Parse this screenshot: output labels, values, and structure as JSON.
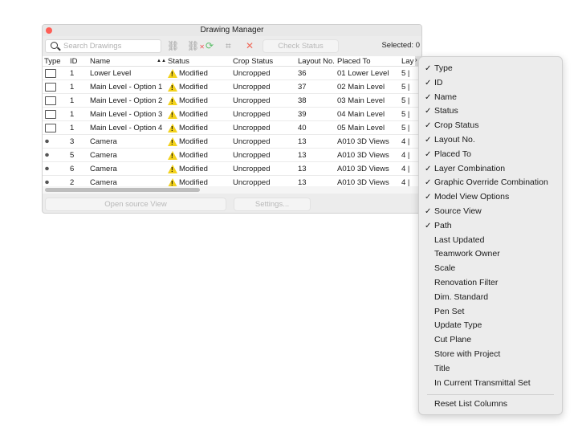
{
  "window": {
    "title": "Drawing Manager"
  },
  "toolbar": {
    "search_placeholder": "Search Drawings",
    "check_status": "Check Status",
    "selected": "Selected: 0"
  },
  "columns": [
    "Type",
    "ID",
    "Name",
    "Status",
    "Crop Status",
    "Layout No.",
    "Placed To",
    "Lay"
  ],
  "sort_indicator": "▲▲",
  "rows": [
    {
      "type": "drawing",
      "id": "1",
      "name": "Lower Level",
      "status": "Modified",
      "crop": "Uncropped",
      "layout": "36",
      "placed": "01 Lower Level",
      "lay": "5 |"
    },
    {
      "type": "drawing",
      "id": "1",
      "name": "Main Level - Option 1",
      "status": "Modified",
      "crop": "Uncropped",
      "layout": "37",
      "placed": "02 Main Level",
      "lay": "5 |"
    },
    {
      "type": "drawing",
      "id": "1",
      "name": "Main Level - Option 2",
      "status": "Modified",
      "crop": "Uncropped",
      "layout": "38",
      "placed": "03 Main Level",
      "lay": "5 |"
    },
    {
      "type": "drawing",
      "id": "1",
      "name": "Main Level - Option 3",
      "status": "Modified",
      "crop": "Uncropped",
      "layout": "39",
      "placed": "04 Main Level",
      "lay": "5 |"
    },
    {
      "type": "drawing",
      "id": "1",
      "name": "Main Level - Option 4",
      "status": "Modified",
      "crop": "Uncropped",
      "layout": "40",
      "placed": "05 Main Level",
      "lay": "5 |"
    },
    {
      "type": "camera",
      "id": "3",
      "name": "Camera",
      "status": "Modified",
      "crop": "Uncropped",
      "layout": "13",
      "placed": "A010 3D Views",
      "lay": "4 |"
    },
    {
      "type": "camera",
      "id": "5",
      "name": "Camera",
      "status": "Modified",
      "crop": "Uncropped",
      "layout": "13",
      "placed": "A010 3D Views",
      "lay": "4 |"
    },
    {
      "type": "camera",
      "id": "6",
      "name": "Camera",
      "status": "Modified",
      "crop": "Uncropped",
      "layout": "13",
      "placed": "A010 3D Views",
      "lay": "4 |"
    },
    {
      "type": "camera",
      "id": "2",
      "name": "Camera",
      "status": "Modified",
      "crop": "Uncropped",
      "layout": "13",
      "placed": "A010 3D Views",
      "lay": "4 |"
    }
  ],
  "buttons": {
    "open_source": "Open source View",
    "settings": "Settings..."
  },
  "menu": {
    "items": [
      {
        "label": "Type",
        "checked": true
      },
      {
        "label": "ID",
        "checked": true
      },
      {
        "label": "Name",
        "checked": true
      },
      {
        "label": "Status",
        "checked": true
      },
      {
        "label": "Crop Status",
        "checked": true
      },
      {
        "label": "Layout No.",
        "checked": true
      },
      {
        "label": "Placed To",
        "checked": true
      },
      {
        "label": "Layer Combination",
        "checked": true
      },
      {
        "label": "Graphic Override Combination",
        "checked": true
      },
      {
        "label": "Model View Options",
        "checked": true
      },
      {
        "label": "Source View",
        "checked": true
      },
      {
        "label": "Path",
        "checked": true
      },
      {
        "label": "Last Updated",
        "checked": false
      },
      {
        "label": "Teamwork Owner",
        "checked": false
      },
      {
        "label": "Scale",
        "checked": false
      },
      {
        "label": "Renovation Filter",
        "checked": false
      },
      {
        "label": "Dim. Standard",
        "checked": false
      },
      {
        "label": "Pen Set",
        "checked": false
      },
      {
        "label": "Update Type",
        "checked": false
      },
      {
        "label": "Cut Plane",
        "checked": false
      },
      {
        "label": "Store with Project",
        "checked": false
      },
      {
        "label": "Title",
        "checked": false
      },
      {
        "label": "In Current Transmittal Set",
        "checked": false
      }
    ],
    "reset": "Reset List Columns",
    "check_glyph": "✓"
  }
}
